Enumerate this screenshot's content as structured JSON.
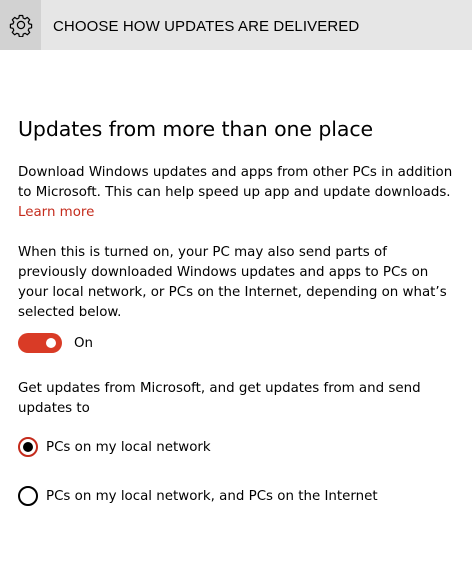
{
  "header": {
    "title": "CHOOSE HOW UPDATES ARE DELIVERED",
    "icon": "gear-icon"
  },
  "main": {
    "heading": "Updates from more than one place",
    "description": "Download Windows updates and apps from other PCs in addition to Microsoft. This can help speed up app and update downloads.",
    "learn_more": "Learn more",
    "info": "When this is turned on, your PC may also send parts of previously downloaded Windows updates and apps to PCs on your local network, or PCs on the Internet, depending on what’s selected below.",
    "toggle": {
      "state": "On",
      "on": true
    },
    "source_prompt": "Get updates from Microsoft, and get updates from and send updates to",
    "options": [
      {
        "label": "PCs on my local network",
        "selected": true
      },
      {
        "label": "PCs on my local network, and PCs on the Internet",
        "selected": false
      }
    ]
  },
  "colors": {
    "accent": "#d93b26",
    "link": "#c42b1c",
    "header_bg": "#e6e6e6",
    "icon_box_bg": "#d2d2d2"
  }
}
